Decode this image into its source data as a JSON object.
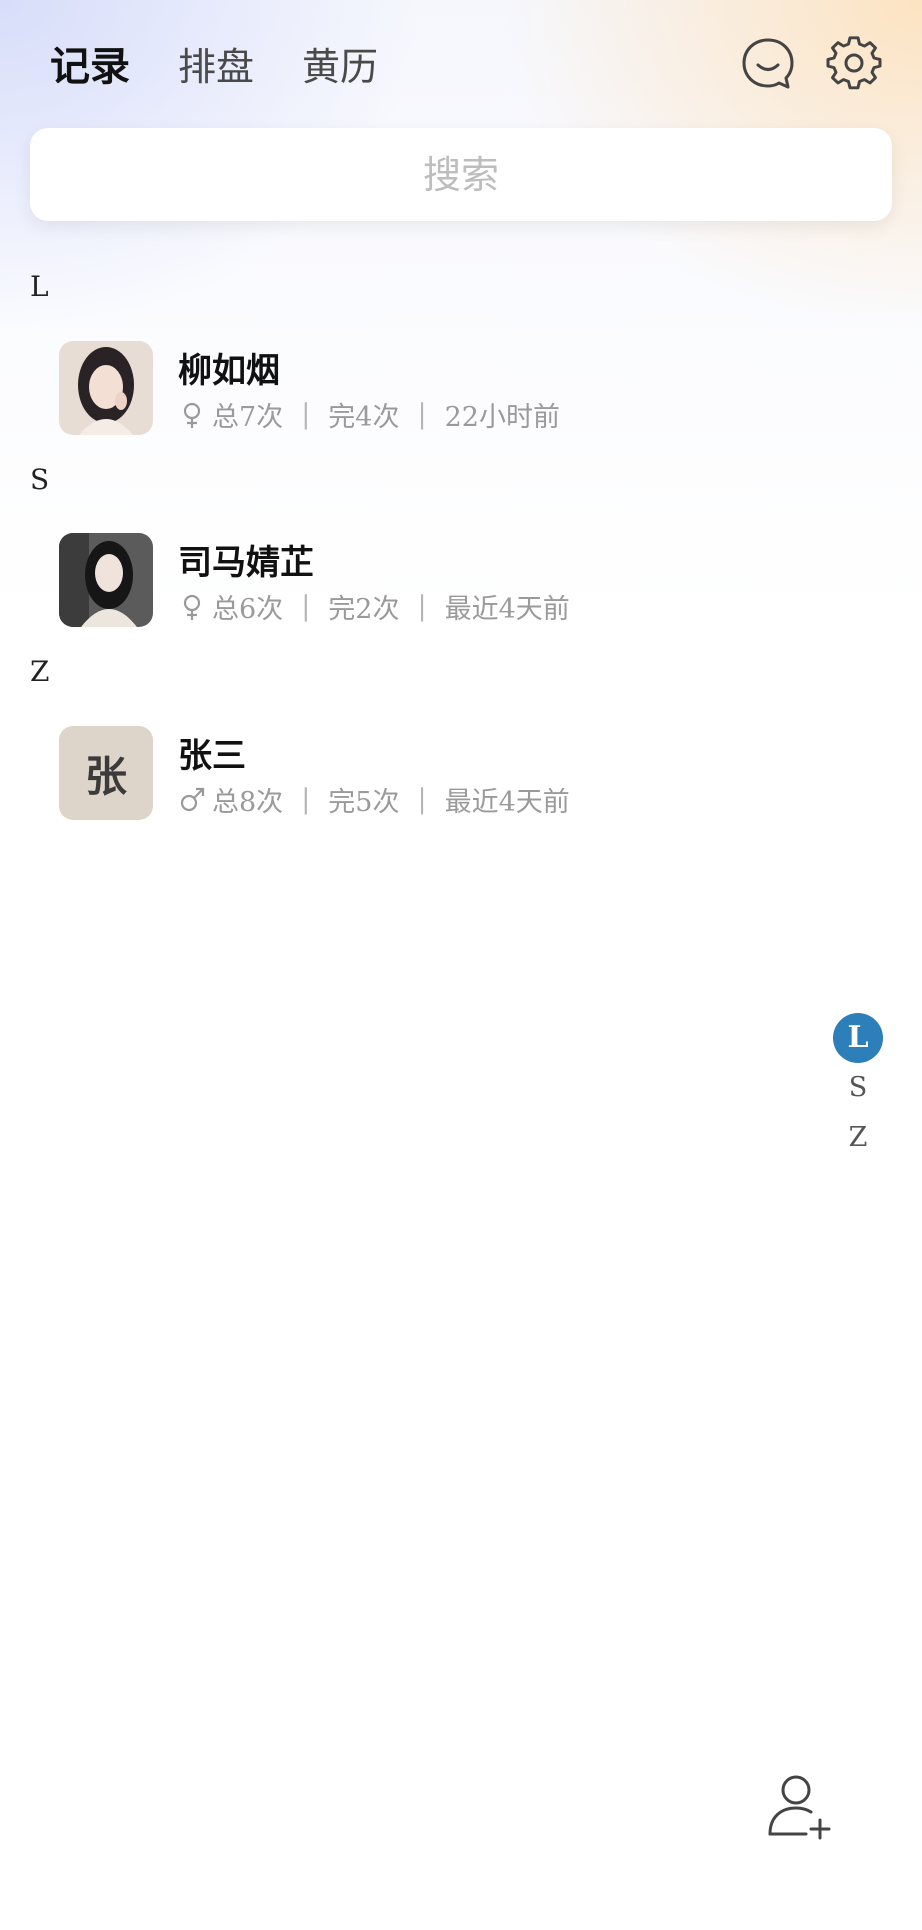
{
  "header": {
    "tabs": [
      {
        "label": "记录",
        "active": true
      },
      {
        "label": "排盘",
        "active": false
      },
      {
        "label": "黄历",
        "active": false
      }
    ],
    "icons": [
      "smile-icon",
      "gear-icon"
    ]
  },
  "search": {
    "placeholder": "搜索",
    "value": ""
  },
  "sections": [
    {
      "letter": "L",
      "contacts": [
        {
          "name": "柳如烟",
          "gender": "female",
          "total": "总7次",
          "done": "完4次",
          "last": "22小时前",
          "avatar": "photo"
        }
      ]
    },
    {
      "letter": "S",
      "contacts": [
        {
          "name": "司马婧芷",
          "gender": "female",
          "total": "总6次",
          "done": "完2次",
          "last": "最近4天前",
          "avatar": "photo"
        }
      ]
    },
    {
      "letter": "Z",
      "contacts": [
        {
          "name": "张三",
          "gender": "male",
          "total": "总8次",
          "done": "完5次",
          "last": "最近4天前",
          "avatar": "张"
        }
      ]
    }
  ],
  "index_bar": {
    "letters": [
      "L",
      "S",
      "Z"
    ],
    "active": "L"
  },
  "fab": {
    "icon": "add-user-icon"
  },
  "colors": {
    "accent": "#2c7fb8",
    "avatar_bg": "#ddd5c9",
    "meta_text": "#9a9a9a"
  }
}
